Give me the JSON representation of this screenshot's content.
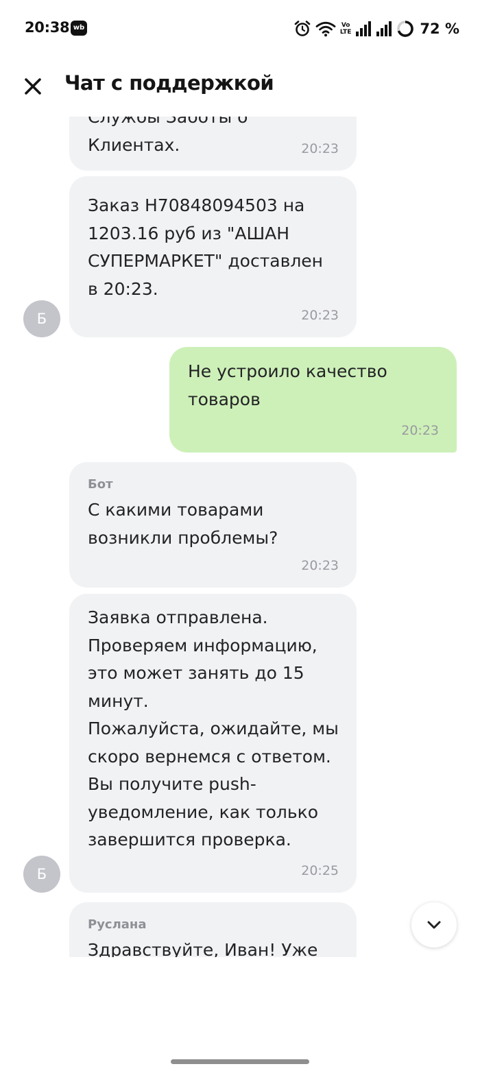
{
  "status_bar": {
    "time": "20:38",
    "app_badge": "wb",
    "volte_top": "Vo",
    "volte_bottom": "LTE",
    "battery_percent": "72 %"
  },
  "header": {
    "title": "Чат с поддержкой"
  },
  "messages": [
    {
      "direction": "incoming",
      "sender": "",
      "text": "Службы Заботы о Клиентах.",
      "time": "20:23"
    },
    {
      "direction": "incoming",
      "sender": "",
      "text": "Заказ H70848094503 на\n1203.16 руб из \"АШАН\nСУПЕРМАРКЕТ\" доставлен\nв 20:23.",
      "time": "20:23",
      "avatar": "Б"
    },
    {
      "direction": "outgoing",
      "sender": "",
      "text": "Не устроило качество\nтоваров",
      "time": "20:23"
    },
    {
      "direction": "incoming",
      "sender": "Бот",
      "text": "С какими товарами\nвозникли проблемы?",
      "time": "20:23"
    },
    {
      "direction": "incoming",
      "sender": "",
      "text": "Заявка отправлена.\nПроверяем информацию,\nэто может занять до 15\nминут.\nПожалуйста, ожидайте, мы\nскоро вернемся с ответом.\nВы получите push-\nуведомление, как только\nзавершится проверка.",
      "time": "20:25",
      "avatar": "Б"
    },
    {
      "direction": "incoming",
      "sender": "Руслана",
      "text": "Здравствуйте, Иван! Уже",
      "time": ""
    }
  ],
  "icons": {
    "close": "close-icon",
    "scroll_down": "chevron-down-icon",
    "alarm": "alarm-icon",
    "wifi": "wifi-icon",
    "signal": "signal-icon",
    "battery": "battery-ring-icon"
  },
  "colors": {
    "incoming_bubble": "#f1f2f4",
    "outgoing_bubble": "#cdf0b8",
    "avatar": "#c4c5cb",
    "timestamp": "#9a9aa1"
  }
}
